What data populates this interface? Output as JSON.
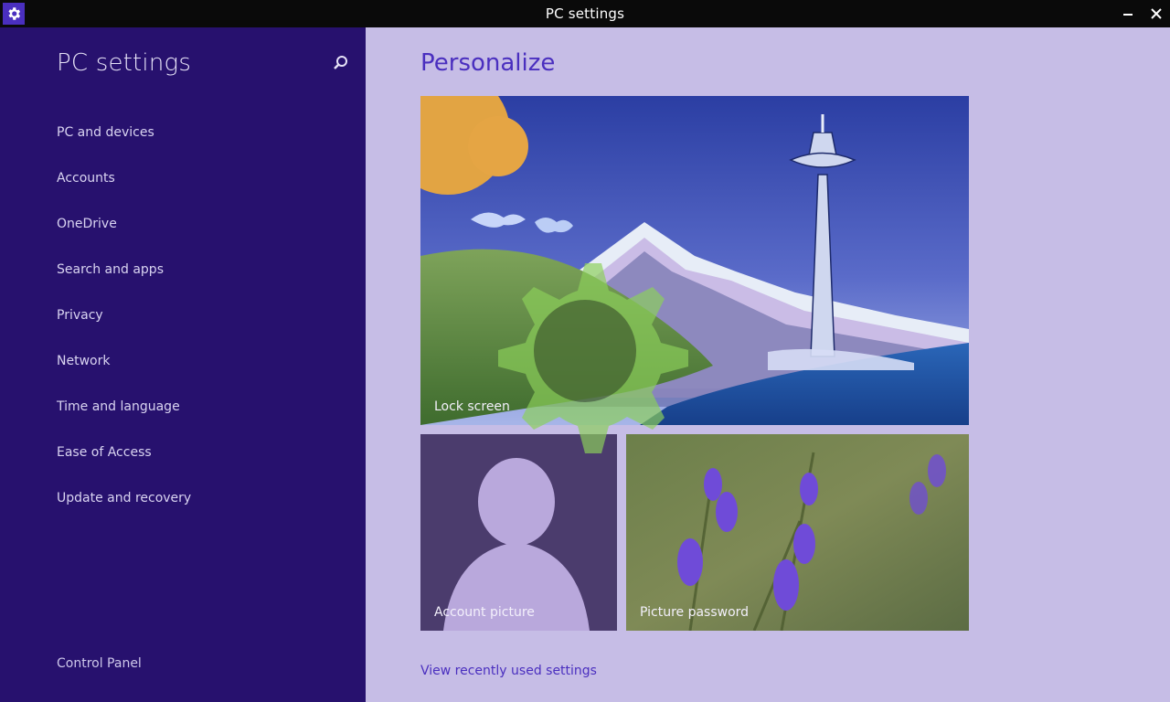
{
  "window": {
    "title": "PC settings",
    "app_icon": "gear-icon",
    "controls": {
      "minimize_icon": "minimize-icon",
      "close_icon": "close-icon"
    }
  },
  "sidebar": {
    "heading": "PC settings",
    "search_icon": "search-icon",
    "items": [
      {
        "label": "PC and devices"
      },
      {
        "label": "Accounts"
      },
      {
        "label": "OneDrive"
      },
      {
        "label": "Search and apps"
      },
      {
        "label": "Privacy"
      },
      {
        "label": "Network"
      },
      {
        "label": "Time and language"
      },
      {
        "label": "Ease of Access"
      },
      {
        "label": "Update and recovery"
      }
    ],
    "control_panel": "Control Panel"
  },
  "main": {
    "title": "Personalize",
    "tiles": {
      "lock_screen": {
        "label": "Lock screen"
      },
      "account_picture": {
        "label": "Account picture"
      },
      "picture_password": {
        "label": "Picture password"
      }
    },
    "recent_link": "View recently used settings"
  },
  "colors": {
    "sidebar_bg": "#27116e",
    "main_bg": "#c6bde6",
    "accent": "#4a2fbf",
    "overlay_gear": "#8ccf5a"
  }
}
